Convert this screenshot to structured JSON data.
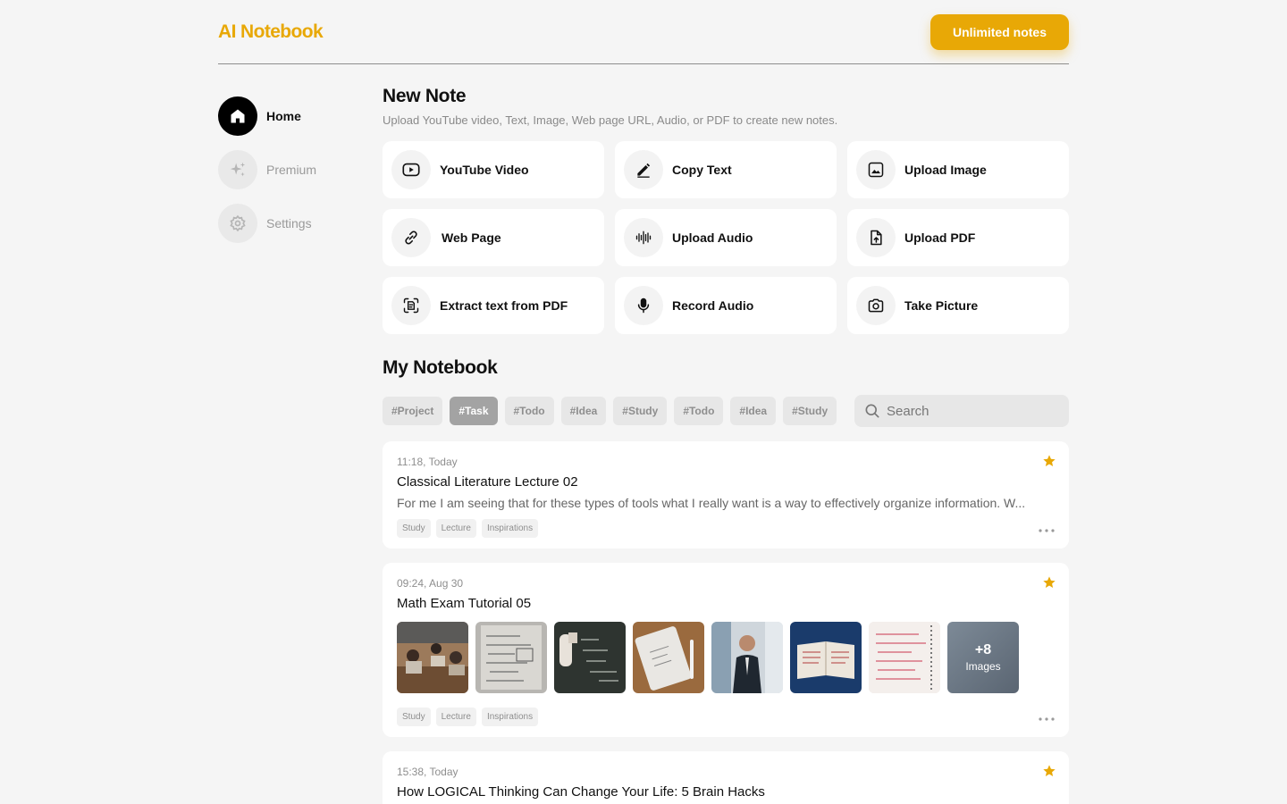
{
  "header": {
    "logo": "AI Notebook",
    "cta_label": "Unlimited notes"
  },
  "nav": [
    {
      "label": "Home",
      "icon": "home-icon",
      "active": true
    },
    {
      "label": "Premium",
      "icon": "sparkle-icon",
      "active": false
    },
    {
      "label": "Settings",
      "icon": "gear-icon",
      "active": false
    }
  ],
  "new_note": {
    "title": "New Note",
    "subtitle": "Upload YouTube video, Text, Image, Web page URL, Audio, or PDF to create new notes.",
    "options": [
      {
        "label": "YouTube Video",
        "icon": "youtube-icon"
      },
      {
        "label": "Copy Text",
        "icon": "pen-icon"
      },
      {
        "label": "Upload Image",
        "icon": "image-icon"
      },
      {
        "label": "Web Page",
        "icon": "link-icon"
      },
      {
        "label": "Upload Audio",
        "icon": "waveform-icon"
      },
      {
        "label": "Upload PDF",
        "icon": "file-upload-icon"
      },
      {
        "label": "Extract text from PDF",
        "icon": "scan-text-icon"
      },
      {
        "label": "Record Audio",
        "icon": "microphone-icon"
      },
      {
        "label": "Take Picture",
        "icon": "camera-icon"
      }
    ]
  },
  "notebook": {
    "title": "My Notebook",
    "filter_tags": [
      "#Project",
      "#Task",
      "#Todo",
      "#Idea",
      "#Study",
      "#Todo",
      "#Idea",
      "#Study"
    ],
    "active_tag_index": 1,
    "search_placeholder": "Search",
    "notes": [
      {
        "time": "11:18, Today",
        "title": "Classical Literature Lecture 02",
        "excerpt": "For me I am seeing that for these types of tools what I really want is a way to effectively organize information. W...",
        "tags": [
          "Study",
          "Lecture",
          "Inspirations"
        ],
        "starred": true
      },
      {
        "time": "09:24, Aug 30",
        "title": "Math Exam Tutorial 05",
        "tags": [
          "Study",
          "Lecture",
          "Inspirations"
        ],
        "starred": true,
        "more_count": "+8",
        "more_label": "Images"
      },
      {
        "time": "15:38, Today",
        "title": "How LOGICAL Thinking Can Change Your Life: 5 Brain Hacks",
        "starred": true
      }
    ]
  },
  "colors": {
    "accent": "#e8a806",
    "background": "#f5f5f5",
    "card": "#ffffff"
  }
}
